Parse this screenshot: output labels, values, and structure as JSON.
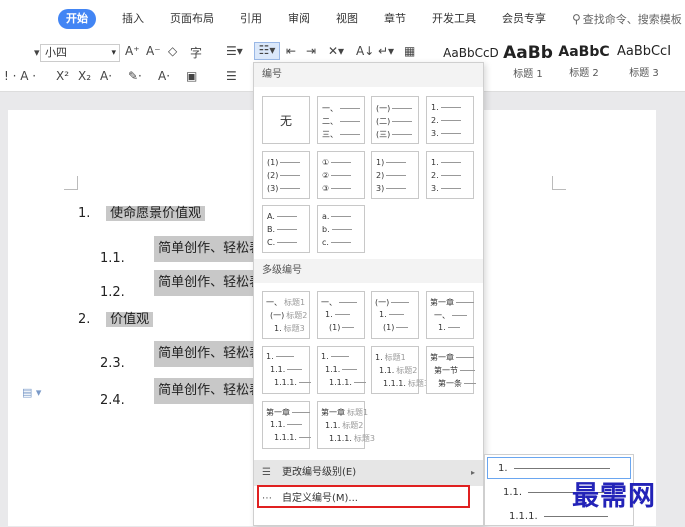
{
  "menubar": {
    "tabs": [
      "开始",
      "插入",
      "页面布局",
      "引用",
      "审阅",
      "视图",
      "章节",
      "开发工具",
      "会员专享"
    ],
    "active_tab": "开始",
    "search_placeholder": "查找命令、搜索模板"
  },
  "ribbon": {
    "font_size": "小四",
    "style_samples": [
      {
        "sample": "AaBbCcD",
        "label": ""
      },
      {
        "sample": "AaBb",
        "label": "标题 1"
      },
      {
        "sample": "AaBbC",
        "label": "标题 2"
      },
      {
        "sample": "AaBbCcI",
        "label": "标题 3"
      }
    ]
  },
  "document": {
    "lines": [
      {
        "num": "1.",
        "text": "使命愿景价值观"
      },
      {
        "num": "1.1.",
        "text": "简单创作、轻松表"
      },
      {
        "num": "1.2.",
        "text": "简单创作、轻松表"
      },
      {
        "num": "2.",
        "text": "价值观"
      },
      {
        "num": "2.3.",
        "text": "简单创作、轻松表"
      },
      {
        "num": "2.4.",
        "text": "简单创作、轻松表"
      }
    ]
  },
  "dropdown": {
    "numbering_title": "编号",
    "none_label": "无",
    "numbering_tiles": [
      [
        "一、",
        "二、",
        "三、"
      ],
      [
        "(一)",
        "(二)",
        "(三)"
      ],
      [
        "1.",
        "2.",
        "3."
      ],
      [
        "(1)",
        "(2)",
        "(3)"
      ],
      [
        "①",
        "②",
        "③"
      ],
      [
        "1)",
        "2)",
        "3)"
      ],
      [
        "1.",
        "2.",
        "3."
      ],
      [
        "A.",
        "B.",
        "C."
      ],
      [
        "a.",
        "b.",
        "c."
      ]
    ],
    "multilevel_title": "多级编号",
    "multilevel_tiles": [
      [
        [
          "一、",
          "标题1"
        ],
        [
          "(一)",
          "标题2"
        ],
        [
          "1.",
          "标题3"
        ]
      ],
      [
        [
          "一、",
          ""
        ],
        [
          "1.",
          ""
        ],
        [
          "(1)",
          ""
        ]
      ],
      [
        [
          "(一)",
          ""
        ],
        [
          "1.",
          ""
        ],
        [
          "(1)",
          ""
        ]
      ],
      [
        [
          "第一章",
          ""
        ],
        [
          "一、",
          ""
        ],
        [
          "1.",
          ""
        ]
      ],
      [
        [
          "1.",
          ""
        ],
        [
          "1.1.",
          ""
        ],
        [
          "1.1.1.",
          ""
        ]
      ],
      [
        [
          "1.",
          ""
        ],
        [
          "1.1.",
          ""
        ],
        [
          "1.1.1.",
          ""
        ]
      ],
      [
        [
          "1.",
          "标题1"
        ],
        [
          "1.1.",
          "标题2"
        ],
        [
          "1.1.1.",
          "标题3"
        ]
      ],
      [
        [
          "第一章",
          ""
        ],
        [
          "第一节",
          ""
        ],
        [
          "第一条",
          ""
        ]
      ],
      [
        [
          "第一章",
          ""
        ],
        [
          "1.1.",
          ""
        ],
        [
          "1.1.1.",
          ""
        ]
      ],
      [
        [
          "第一章",
          "标题1"
        ],
        [
          "1.1.",
          "标题2"
        ],
        [
          "1.1.1.",
          "标题3"
        ]
      ]
    ],
    "change_level_label": "更改编号级别(E)",
    "custom_label": "自定义编号(M)..."
  },
  "submenu": {
    "items": [
      "1.",
      "1.1.",
      "1.1.1."
    ]
  },
  "watermark": "最需网",
  "colors": {
    "accent": "#4285f4",
    "highlight": "#c8c8c8",
    "custom_outline": "#e02020",
    "watermark": "#2323b8"
  }
}
